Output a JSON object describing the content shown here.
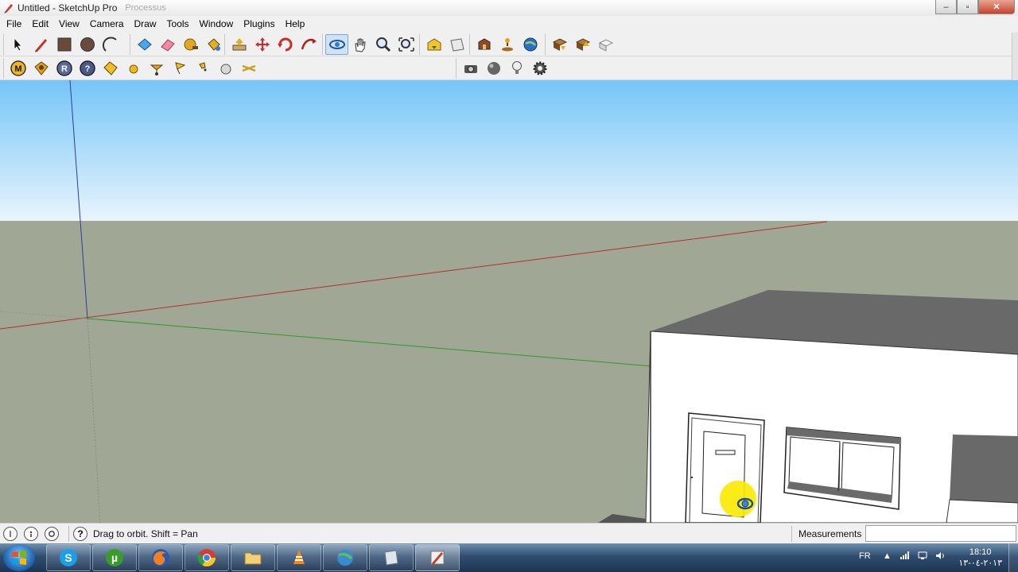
{
  "window": {
    "title": "Untitled - SketchUp Pro",
    "ghost_title": "Processus",
    "minimize_label": "–",
    "maximize_label": "▫",
    "close_label": "✕"
  },
  "menu": [
    "File",
    "Edit",
    "View",
    "Camera",
    "Draw",
    "Tools",
    "Window",
    "Plugins",
    "Help"
  ],
  "toolbar_icons": {
    "row1": [
      "select-icon",
      "line-icon",
      "rectangle-icon",
      "circle-icon",
      "arc-icon",
      "make-component-icon",
      "eraser-icon",
      "tape-measure-icon",
      "paint-bucket-icon",
      "push-pull-icon",
      "move-icon",
      "rotate-icon",
      "follow-me-icon",
      "orbit-icon",
      "pan-icon",
      "zoom-icon",
      "zoom-extents-icon",
      "warehouse-icon",
      "share-model-icon",
      "photo-textures-icon",
      "add-location-icon",
      "google-earth-icon",
      "get-models-icon",
      "share-component-icon",
      "extension-icon"
    ],
    "row2": [
      "m-icon",
      "gem-icon",
      "r-icon",
      "question-icon",
      "tag-icon",
      "dot-icon",
      "cone-icon",
      "flag-icon",
      "pin-icon",
      "sphere-icon",
      "lines-icon",
      "camera-icon",
      "ball-icon",
      "bulb-icon",
      "gear-icon"
    ]
  },
  "statusbar": {
    "hint": "Drag to orbit.  Shift = Pan",
    "help_label": "?",
    "measurements_label": "Measurements",
    "measurements_value": ""
  },
  "taskbar": {
    "apps": [
      "skype-icon",
      "utorrent-icon",
      "firefox-icon",
      "chrome-icon",
      "folder-icon",
      "vlc-icon",
      "network-icon",
      "notes-icon",
      "sketchup-icon"
    ],
    "language": "FR",
    "time": "18:10",
    "date": "٢٠١٣-٠٤-١٣"
  },
  "colors": {
    "sky_top": "#75c5f8",
    "sky_bottom": "#e8f4fc",
    "ground": "#a0a895",
    "red_axis": "#b03030",
    "green_axis": "#2f9a2f",
    "blue_axis": "#2c3f95",
    "roof": "#696969",
    "wall": "#ffffff",
    "cursor_highlight": "#fbea00"
  }
}
